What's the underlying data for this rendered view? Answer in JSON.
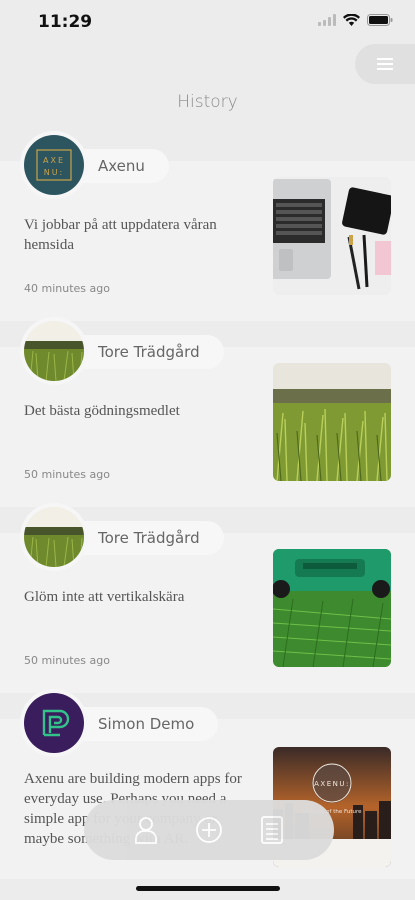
{
  "status_bar": {
    "time": "11:29"
  },
  "header": {
    "title": "History",
    "menu_icon": "hamburger-icon"
  },
  "posts": [
    {
      "author": "Axenu",
      "avatar": "axenu-logo",
      "text": "Vi jobbar på att uppdatera våran hemsida",
      "time_ago": "40 minutes ago",
      "image": "laptop-desk-photo"
    },
    {
      "author": "Tore Trädgård",
      "avatar": "grass-photo",
      "text": "Det bästa gödningsmedlet",
      "time_ago": "50 minutes ago",
      "image": "grass-closeup-photo"
    },
    {
      "author": "Tore Trädgård",
      "avatar": "grass-photo",
      "text": "Glöm inte att vertikalskära",
      "time_ago": "50 minutes ago",
      "image": "lawn-mower-photo"
    },
    {
      "author": "Simon Demo",
      "avatar": "simon-logo",
      "text": "Axenu are building modern apps for everyday use. Perhaps you need a simple app for your company or maybe something with AR.",
      "time_ago": "",
      "image": "axenu-city-photo",
      "image_caption": "Website of the Future",
      "image_logo_text": "AXENU:"
    }
  ],
  "bottom_nav": {
    "items": [
      "profile-icon",
      "add-icon",
      "list-icon"
    ]
  },
  "colors": {
    "background": "#ececec",
    "card": "#f2f2f2",
    "nav": "#dcdcdc",
    "axenu_teal": "#2d5560",
    "simon_purple": "#3a1d5c"
  }
}
